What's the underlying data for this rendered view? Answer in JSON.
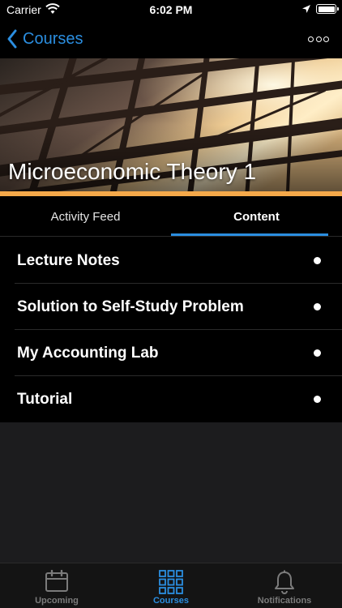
{
  "status_bar": {
    "carrier": "Carrier",
    "time": "6:02 PM"
  },
  "nav": {
    "back_label": "Courses"
  },
  "course": {
    "title": "Microeconomic Theory 1"
  },
  "tabs": [
    {
      "label": "Activity Feed",
      "selected": false
    },
    {
      "label": "Content",
      "selected": true
    }
  ],
  "content_items": [
    {
      "label": "Lecture Notes"
    },
    {
      "label": "Solution to Self-Study Problem"
    },
    {
      "label": "My Accounting Lab"
    },
    {
      "label": "Tutorial"
    }
  ],
  "tab_bar": [
    {
      "label": "Upcoming",
      "icon": "calendar-icon",
      "active": false
    },
    {
      "label": "Courses",
      "icon": "grid-icon",
      "active": true
    },
    {
      "label": "Notifications",
      "icon": "bell-icon",
      "active": false
    }
  ],
  "colors": {
    "accent": "#2b8ee0",
    "hero_strip": "#f5a94a",
    "background": "#000000"
  }
}
